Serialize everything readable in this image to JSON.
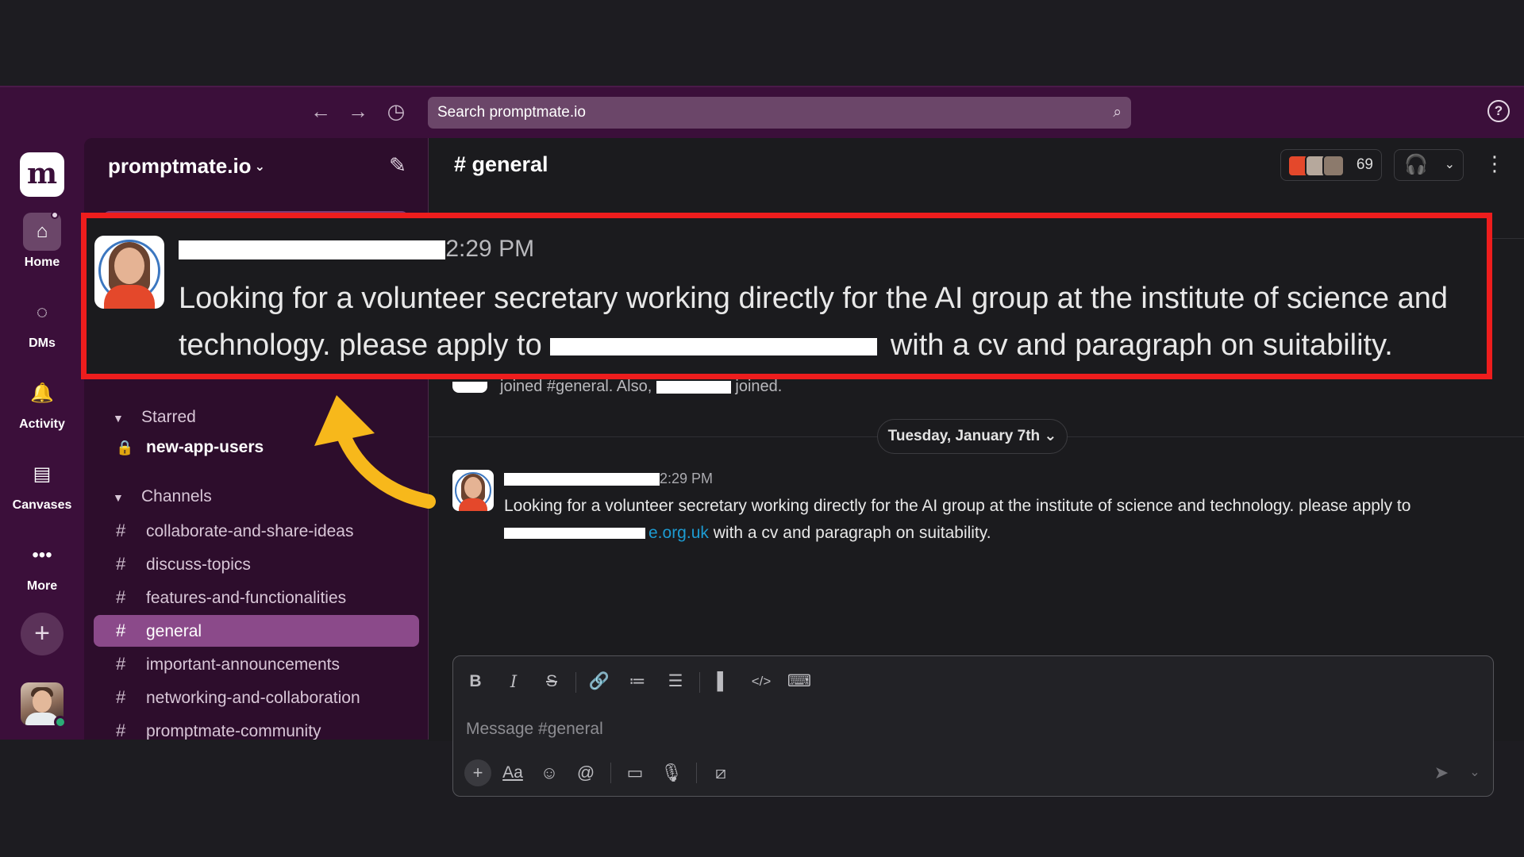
{
  "topbar": {
    "back": "←",
    "forward": "→",
    "history": "◷",
    "search_placeholder": "Search promptmate.io",
    "search_icon": "⌕",
    "help": "?"
  },
  "rail": {
    "workspace_logo": "m",
    "items": [
      {
        "label": "Home",
        "icon": "⌂"
      },
      {
        "label": "DMs",
        "icon": "◌"
      },
      {
        "label": "Activity",
        "icon": "🔔"
      },
      {
        "label": "Canvases",
        "icon": "▤"
      },
      {
        "label": "More",
        "icon": "•••"
      }
    ],
    "add": "+"
  },
  "sidebar": {
    "workspace_name": "promptmate.io",
    "chevron": "⌄",
    "compose_icon": "✎",
    "starred": {
      "title": "Starred",
      "items": [
        {
          "name": "new-app-users",
          "icon": "🔒"
        }
      ]
    },
    "channels": {
      "title": "Channels",
      "items": [
        "collaborate-and-share-ideas",
        "discuss-topics",
        "features-and-functionalities",
        "general",
        "important-announcements",
        "networking-and-collaboration",
        "promptmate-community"
      ],
      "active": "general"
    },
    "hash": "#"
  },
  "main": {
    "channel_title": "# general",
    "member_count": "69",
    "huddle_icon": "🎧",
    "dropdown": "⌄",
    "kebab": "⋮",
    "join_text_a": "joined #general. Also,",
    "join_text_b": "joined.",
    "date_pill": "Tuesday, January 7th ⌄",
    "message": {
      "time_fragment": "2:29 PM",
      "text": "Looking for a volunteer secretary working directly for the AI group at the institute of science and technology. please apply to",
      "link_fragment": "e.org.uk",
      "text_after": "with a cv and paragraph on suitability."
    },
    "composer": {
      "placeholder": "Message #general",
      "format_buttons": [
        "B",
        "I",
        "S",
        "🔗",
        "≔",
        "☰",
        "▌",
        "</>",
        "⌨"
      ],
      "tools": [
        "+",
        "Aa",
        "☺",
        "@",
        "▭",
        "🎙",
        "⧄"
      ],
      "send": "➤",
      "send_menu": "⌄"
    }
  },
  "callout": {
    "time_fragment": "2:29 PM",
    "text_a": "Looking for a volunteer secretary working directly for the AI group at the institute of science and technology. please apply to",
    "text_b": "with a cv and paragraph on suitability."
  },
  "colors": {
    "aubergine": "#3b0f3a",
    "sidebar": "#2d0d2c",
    "active_channel": "#8b4a8a",
    "highlight_border": "#ee1d1d",
    "arrow": "#f7b81b",
    "link": "#1d9bd1"
  }
}
